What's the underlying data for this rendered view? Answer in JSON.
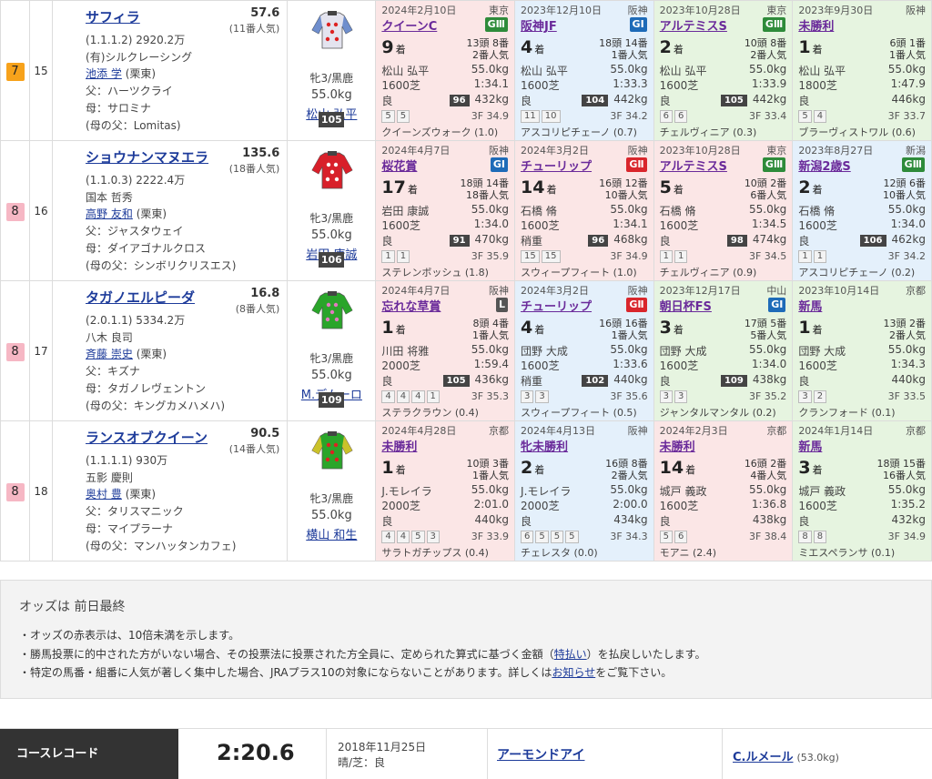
{
  "horses": [
    {
      "waku": "7",
      "waku_bg": "#f7a21b",
      "waku_fg": "#222",
      "umaban": "15",
      "name": "サフィラ",
      "odds": "57.6",
      "ninki": "(11番人気)",
      "record": "(1.1.1.2) 2920.2万",
      "owner": "(有)シルクレーシング",
      "trainer": "池添 学",
      "trainer_region": "(栗東)",
      "sire": "父：ハーツクライ",
      "dam": "母：サロミナ",
      "damsire": "(母の父：Lomitas)",
      "silk_icon": "jockey-silk-icon",
      "silk_color": "#e4e4ef",
      "silk_accent": "#d22",
      "silk_sleeve": "#5b7fc7",
      "sex_age": "牝3/黒鹿",
      "weight": "55.0kg",
      "jockey": "松山 弘平",
      "rating": "105",
      "past": [
        {
          "date": "2024年2月10日",
          "place": "東京",
          "race": "クイーンC",
          "grade": "GⅢ",
          "grade_class": "g-g3",
          "bg": "bg-pink",
          "pos": "9",
          "pos_unit": "着",
          "field": "13頭 8番",
          "field2": "2番人気",
          "jockey": "松山 弘平",
          "weight": "55.0kg",
          "dist": "1600芝",
          "time": "1:34.1",
          "cond": "良",
          "bw": "96",
          "kg": "432kg",
          "corners": [
            "5",
            "5"
          ],
          "f3": "3F 34.9",
          "winner": "クイーンズウォーク (1.0)"
        },
        {
          "date": "2023年12月10日",
          "place": "阪神",
          "race": "阪神JF",
          "grade": "GⅠ",
          "grade_class": "g-g1",
          "bg": "bg-blue",
          "pos": "4",
          "pos_unit": "着",
          "field": "18頭 14番",
          "field2": "1番人気",
          "jockey": "松山 弘平",
          "weight": "55.0kg",
          "dist": "1600芝",
          "time": "1:33.3",
          "cond": "良",
          "bw": "104",
          "kg": "442kg",
          "corners": [
            "11",
            "10"
          ],
          "f3": "3F 34.2",
          "winner": "アスコリピチェーノ (0.7)"
        },
        {
          "date": "2023年10月28日",
          "place": "東京",
          "race": "アルテミスS",
          "grade": "GⅢ",
          "grade_class": "g-g3",
          "bg": "bg-green",
          "pos": "2",
          "pos_unit": "着",
          "field": "10頭 8番",
          "field2": "2番人気",
          "jockey": "松山 弘平",
          "weight": "55.0kg",
          "dist": "1600芝",
          "time": "1:33.9",
          "cond": "良",
          "bw": "105",
          "kg": "442kg",
          "corners": [
            "6",
            "6"
          ],
          "f3": "3F 33.4",
          "winner": "チェルヴィニア (0.3)"
        },
        {
          "date": "2023年9月30日",
          "place": "阪神",
          "race": "未勝利",
          "grade": "",
          "grade_class": "",
          "bg": "bg-green",
          "pos": "1",
          "pos_unit": "着",
          "field": "6頭 1番",
          "field2": "1番人気",
          "jockey": "松山 弘平",
          "weight": "55.0kg",
          "dist": "1800芝",
          "time": "1:47.9",
          "cond": "良",
          "bw": "",
          "kg": "446kg",
          "corners": [
            "5",
            "4"
          ],
          "f3": "3F 33.7",
          "winner": "ブラーヴィストワル (0.6)"
        }
      ]
    },
    {
      "waku": "8",
      "waku_bg": "#f6b7c4",
      "waku_fg": "#222",
      "umaban": "16",
      "name": "ショウナンマヌエラ",
      "odds": "135.6",
      "ninki": "(18番人気)",
      "record": "(1.1.0.3) 2222.4万",
      "owner": "国本 哲秀",
      "trainer": "高野 友和",
      "trainer_region": "(栗東)",
      "sire": "父：ジャスタウェイ",
      "dam": "母：ダイアゴナルクロス",
      "damsire": "(母の父：シンボリクリスエス)",
      "silk_icon": "jockey-silk-icon",
      "silk_color": "#d8202a",
      "silk_accent": "#fff",
      "silk_sleeve": "#d8202a",
      "sex_age": "牝3/黒鹿",
      "weight": "55.0kg",
      "jockey": "岩田 康誠",
      "rating": "106",
      "past": [
        {
          "date": "2024年4月7日",
          "place": "阪神",
          "race": "桜花賞",
          "grade": "GⅠ",
          "grade_class": "g-g1",
          "bg": "bg-pink",
          "pos": "17",
          "pos_unit": "着",
          "field": "18頭 14番",
          "field2": "18番人気",
          "jockey": "岩田 康誠",
          "weight": "55.0kg",
          "dist": "1600芝",
          "time": "1:34.0",
          "cond": "良",
          "bw": "91",
          "kg": "470kg",
          "corners": [
            "1",
            "1"
          ],
          "f3": "3F 35.9",
          "winner": "ステレンボッシュ (1.8)"
        },
        {
          "date": "2024年3月2日",
          "place": "阪神",
          "race": "チューリップ",
          "grade": "GⅡ",
          "grade_class": "g-g2",
          "bg": "bg-pink",
          "pos": "14",
          "pos_unit": "着",
          "field": "16頭 12番",
          "field2": "10番人気",
          "jockey": "石橋 脩",
          "weight": "55.0kg",
          "dist": "1600芝",
          "time": "1:34.1",
          "cond": "稍重",
          "bw": "96",
          "kg": "468kg",
          "corners": [
            "15",
            "15"
          ],
          "f3": "3F 34.9",
          "winner": "スウィープフィート (1.0)"
        },
        {
          "date": "2023年10月28日",
          "place": "東京",
          "race": "アルテミスS",
          "grade": "GⅢ",
          "grade_class": "g-g3",
          "bg": "bg-pink",
          "pos": "5",
          "pos_unit": "着",
          "field": "10頭 2番",
          "field2": "6番人気",
          "jockey": "石橋 脩",
          "weight": "55.0kg",
          "dist": "1600芝",
          "time": "1:34.5",
          "cond": "良",
          "bw": "98",
          "kg": "474kg",
          "corners": [
            "1",
            "1"
          ],
          "f3": "3F 34.5",
          "winner": "チェルヴィニア (0.9)"
        },
        {
          "date": "2023年8月27日",
          "place": "新潟",
          "race": "新潟2歳S",
          "grade": "GⅢ",
          "grade_class": "g-g3",
          "bg": "bg-blue",
          "pos": "2",
          "pos_unit": "着",
          "field": "12頭 6番",
          "field2": "10番人気",
          "jockey": "石橋 脩",
          "weight": "55.0kg",
          "dist": "1600芝",
          "time": "1:34.0",
          "cond": "良",
          "bw": "106",
          "kg": "462kg",
          "corners": [
            "1",
            "1"
          ],
          "f3": "3F 34.2",
          "winner": "アスコリピチェーノ (0.2)"
        }
      ]
    },
    {
      "waku": "8",
      "waku_bg": "#f6b7c4",
      "waku_fg": "#222",
      "umaban": "17",
      "name": "タガノエルピーダ",
      "odds": "16.8",
      "ninki": "(8番人気)",
      "record": "(2.0.1.1) 5334.2万",
      "owner": "八木 良司",
      "trainer": "斉藤 崇史",
      "trainer_region": "(栗東)",
      "sire": "父：キズナ",
      "dam": "母：タガノレヴェントン",
      "damsire": "(母の父：キングカメハメハ)",
      "silk_icon": "jockey-silk-icon",
      "silk_color": "#2aa52a",
      "silk_accent": "#e27ac0",
      "silk_sleeve": "#2aa52a",
      "sex_age": "牝3/黒鹿",
      "weight": "55.0kg",
      "jockey": "M.デムーロ",
      "rating": "109",
      "past": [
        {
          "date": "2024年4月7日",
          "place": "阪神",
          "race": "忘れな草賞",
          "grade": "L",
          "grade_class": "g-l",
          "bg": "bg-pink",
          "pos": "1",
          "pos_unit": "着",
          "field": "8頭 4番",
          "field2": "1番人気",
          "jockey": "川田 将雅",
          "weight": "55.0kg",
          "dist": "2000芝",
          "time": "1:59.4",
          "cond": "良",
          "bw": "105",
          "kg": "436kg",
          "corners": [
            "4",
            "4",
            "4",
            "1"
          ],
          "f3": "3F 35.3",
          "winner": "ステラクラウン (0.4)"
        },
        {
          "date": "2024年3月2日",
          "place": "阪神",
          "race": "チューリップ",
          "grade": "GⅡ",
          "grade_class": "g-g2",
          "bg": "bg-blue",
          "pos": "4",
          "pos_unit": "着",
          "field": "16頭 16番",
          "field2": "1番人気",
          "jockey": "団野 大成",
          "weight": "55.0kg",
          "dist": "1600芝",
          "time": "1:33.6",
          "cond": "稍重",
          "bw": "102",
          "kg": "440kg",
          "corners": [
            "3",
            "3"
          ],
          "f3": "3F 35.6",
          "winner": "スウィープフィート (0.5)"
        },
        {
          "date": "2023年12月17日",
          "place": "中山",
          "race": "朝日杯FS",
          "grade": "GⅠ",
          "grade_class": "g-g1",
          "bg": "bg-green",
          "pos": "3",
          "pos_unit": "着",
          "field": "17頭 5番",
          "field2": "5番人気",
          "jockey": "団野 大成",
          "weight": "55.0kg",
          "dist": "1600芝",
          "time": "1:34.0",
          "cond": "良",
          "bw": "109",
          "kg": "438kg",
          "corners": [
            "3",
            "3"
          ],
          "f3": "3F 35.2",
          "winner": "ジャンタルマンタル (0.2)"
        },
        {
          "date": "2023年10月14日",
          "place": "京都",
          "race": "新馬",
          "grade": "",
          "grade_class": "",
          "bg": "bg-green",
          "pos": "1",
          "pos_unit": "着",
          "field": "13頭 2番",
          "field2": "2番人気",
          "jockey": "団野 大成",
          "weight": "55.0kg",
          "dist": "1600芝",
          "time": "1:34.3",
          "cond": "良",
          "bw": "",
          "kg": "440kg",
          "corners": [
            "3",
            "2"
          ],
          "f3": "3F 33.5",
          "winner": "クランフォード (0.1)"
        }
      ]
    },
    {
      "waku": "8",
      "waku_bg": "#f6b7c4",
      "waku_fg": "#222",
      "umaban": "18",
      "name": "ランスオブクイーン",
      "odds": "90.5",
      "ninki": "(14番人気)",
      "record": "(1.1.1.1) 930万",
      "owner": "五影 慶則",
      "trainer": "奥村 豊",
      "trainer_region": "(栗東)",
      "sire": "父：タリスマニック",
      "dam": "母：マイプラーナ",
      "damsire": "(母の父：マンハッタンカフェ)",
      "silk_icon": "jockey-silk-icon",
      "silk_color": "#2aa52a",
      "silk_accent": "#d22",
      "silk_sleeve": "#e6c72a",
      "sex_age": "牝3/黒鹿",
      "weight": "55.0kg",
      "jockey": "横山 和生",
      "rating": "",
      "past": [
        {
          "date": "2024年4月28日",
          "place": "京都",
          "race": "未勝利",
          "grade": "",
          "grade_class": "",
          "bg": "bg-pink",
          "pos": "1",
          "pos_unit": "着",
          "field": "10頭 3番",
          "field2": "1番人気",
          "jockey": "J.モレイラ",
          "weight": "55.0kg",
          "dist": "2000芝",
          "time": "2:01.0",
          "cond": "良",
          "bw": "",
          "kg": "440kg",
          "corners": [
            "4",
            "4",
            "5",
            "3"
          ],
          "f3": "3F 33.9",
          "winner": "サラトガチップス (0.4)"
        },
        {
          "date": "2024年4月13日",
          "place": "阪神",
          "race": "牝未勝利",
          "grade": "",
          "grade_class": "",
          "bg": "bg-blue",
          "pos": "2",
          "pos_unit": "着",
          "field": "16頭 8番",
          "field2": "2番人気",
          "jockey": "J.モレイラ",
          "weight": "55.0kg",
          "dist": "2000芝",
          "time": "2:00.0",
          "cond": "良",
          "bw": "",
          "kg": "434kg",
          "corners": [
            "6",
            "5",
            "5",
            "5"
          ],
          "f3": "3F 34.3",
          "winner": "チェレスタ (0.0)"
        },
        {
          "date": "2024年2月3日",
          "place": "京都",
          "race": "未勝利",
          "grade": "",
          "grade_class": "",
          "bg": "bg-pink",
          "pos": "14",
          "pos_unit": "着",
          "field": "16頭 2番",
          "field2": "4番人気",
          "jockey": "城戸 義政",
          "weight": "55.0kg",
          "dist": "1600芝",
          "time": "1:36.8",
          "cond": "良",
          "bw": "",
          "kg": "438kg",
          "corners": [
            "5",
            "6"
          ],
          "f3": "3F 38.4",
          "winner": "モアニ (2.4)"
        },
        {
          "date": "2024年1月14日",
          "place": "京都",
          "race": "新馬",
          "grade": "",
          "grade_class": "",
          "bg": "bg-green",
          "pos": "3",
          "pos_unit": "着",
          "field": "18頭 15番",
          "field2": "16番人気",
          "jockey": "城戸 義政",
          "weight": "55.0kg",
          "dist": "1600芝",
          "time": "1:35.2",
          "cond": "良",
          "bw": "",
          "kg": "432kg",
          "corners": [
            "8",
            "8"
          ],
          "f3": "3F 34.9",
          "winner": "ミエスペランサ (0.1)"
        }
      ]
    }
  ],
  "notes": {
    "title": "オッズは 前日最終",
    "line1": "・オッズの赤表示は、10倍未満を示します。",
    "line2a": "・勝馬投票に的中された方がいない場合、その投票法に投票された方全員に、定められた算式に基づく金額（",
    "line2link": "特払い",
    "line2b": "）を払戻しいたします。",
    "line3a": "・特定の馬番・組番に人気が著しく集中した場合、JRAプラス10の対象にならないことがあります。詳しくは",
    "line3link": "お知らせ",
    "line3b": "をご覧下さい。"
  },
  "course_record": {
    "label": "コースレコード",
    "time": "2:20.6",
    "date": "2018年11月25日",
    "weather": "晴/芝：良",
    "horse": "アーモンドアイ",
    "jockey": "C.ルメール",
    "jockey_weight": "(53.0kg)"
  }
}
